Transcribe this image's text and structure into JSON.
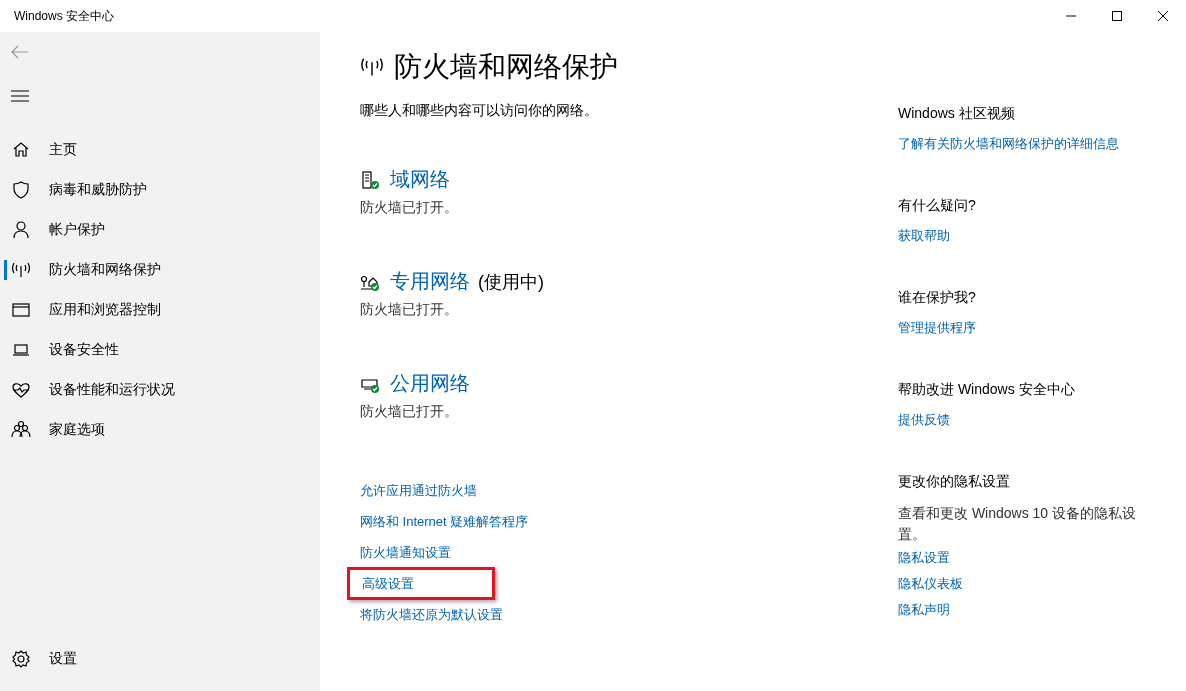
{
  "window": {
    "title": "Windows 安全中心"
  },
  "sidebar": {
    "items": [
      {
        "label": "主页",
        "selected": false
      },
      {
        "label": "病毒和威胁防护",
        "selected": false
      },
      {
        "label": "帐户保护",
        "selected": false
      },
      {
        "label": "防火墙和网络保护",
        "selected": true
      },
      {
        "label": "应用和浏览器控制",
        "selected": false
      },
      {
        "label": "设备安全性",
        "selected": false
      },
      {
        "label": "设备性能和运行状况",
        "selected": false
      },
      {
        "label": "家庭选项",
        "selected": false
      }
    ],
    "settings": "设置"
  },
  "page": {
    "title": "防火墙和网络保护",
    "subtitle": "哪些人和哪些内容可以访问你的网络。",
    "networks": [
      {
        "kind": "domain",
        "name": "域网络",
        "status": "防火墙已打开。"
      },
      {
        "kind": "private",
        "name": "专用网络",
        "note": "(使用中)",
        "status": "防火墙已打开。"
      },
      {
        "kind": "public",
        "name": "公用网络",
        "status": "防火墙已打开。"
      }
    ],
    "links": [
      {
        "label": "允许应用通过防火墙",
        "highlighted": false
      },
      {
        "label": "网络和 Internet 疑难解答程序",
        "highlighted": false
      },
      {
        "label": "防火墙通知设置",
        "highlighted": false
      },
      {
        "label": "高级设置",
        "highlighted": true
      },
      {
        "label": "将防火墙还原为默认设置",
        "highlighted": false
      }
    ]
  },
  "side_panel": [
    {
      "heading": "Windows 社区视频",
      "links": [
        "了解有关防火墙和网络保护的详细信息"
      ]
    },
    {
      "heading": "有什么疑问?",
      "links": [
        "获取帮助"
      ]
    },
    {
      "heading": "谁在保护我?",
      "links": [
        "管理提供程序"
      ]
    },
    {
      "heading": "帮助改进 Windows 安全中心",
      "links": [
        "提供反馈"
      ]
    },
    {
      "heading": "更改你的隐私设置",
      "text": "查看和更改 Windows 10 设备的隐私设置。",
      "links": [
        "隐私设置",
        "隐私仪表板",
        "隐私声明"
      ]
    }
  ]
}
